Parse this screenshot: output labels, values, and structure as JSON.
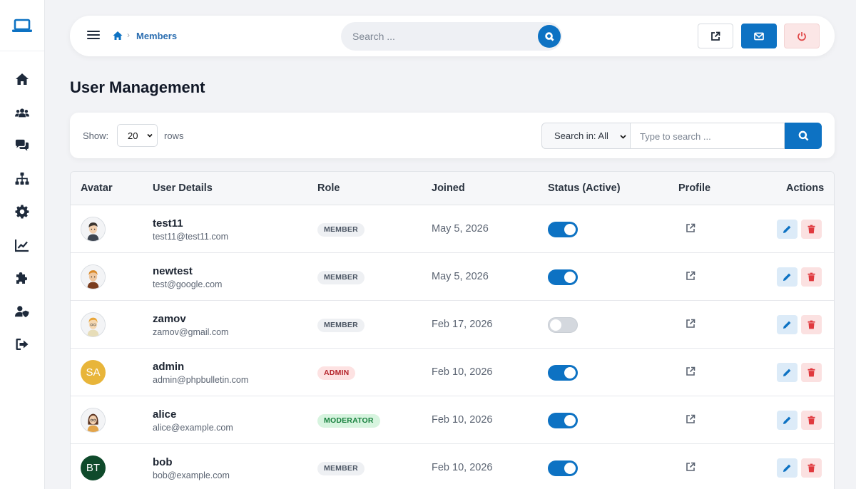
{
  "breadcrumb": {
    "current": "Members",
    "separator": "›"
  },
  "top_search": {
    "placeholder": "Search ..."
  },
  "page": {
    "title": "User Management"
  },
  "controls": {
    "show_label": "Show:",
    "rows_value": "20",
    "rows_label": "rows",
    "scope_value": "Search in: All",
    "search_placeholder": "Type to search ..."
  },
  "table": {
    "headers": {
      "avatar": "Avatar",
      "details": "User Details",
      "role": "Role",
      "joined": "Joined",
      "status": "Status (Active)",
      "profile": "Profile",
      "actions": "Actions"
    },
    "rows": [
      {
        "name": "test11",
        "email": "test11@test11.com",
        "role": "MEMBER",
        "joined": "May 5, 2026",
        "active": true
      },
      {
        "name": "newtest",
        "email": "test@google.com",
        "role": "MEMBER",
        "joined": "May 5, 2026",
        "active": true
      },
      {
        "name": "zamov",
        "email": "zamov@gmail.com",
        "role": "MEMBER",
        "joined": "Feb 17, 2026",
        "active": false
      },
      {
        "name": "admin",
        "email": "admin@phpbulletin.com",
        "role": "ADMIN",
        "joined": "Feb 10, 2026",
        "active": true,
        "initials": "SA"
      },
      {
        "name": "alice",
        "email": "alice@example.com",
        "role": "MODERATOR",
        "joined": "Feb 10, 2026",
        "active": true
      },
      {
        "name": "bob",
        "email": "bob@example.com",
        "role": "MEMBER",
        "joined": "Feb 10, 2026",
        "active": true,
        "initials": "BT"
      }
    ]
  },
  "colors": {
    "primary": "#0d72c3",
    "sidebar_icon": "#1e2a3b",
    "admin_avatar": "#e8b53a",
    "bob_avatar": "#0f4a2b"
  }
}
